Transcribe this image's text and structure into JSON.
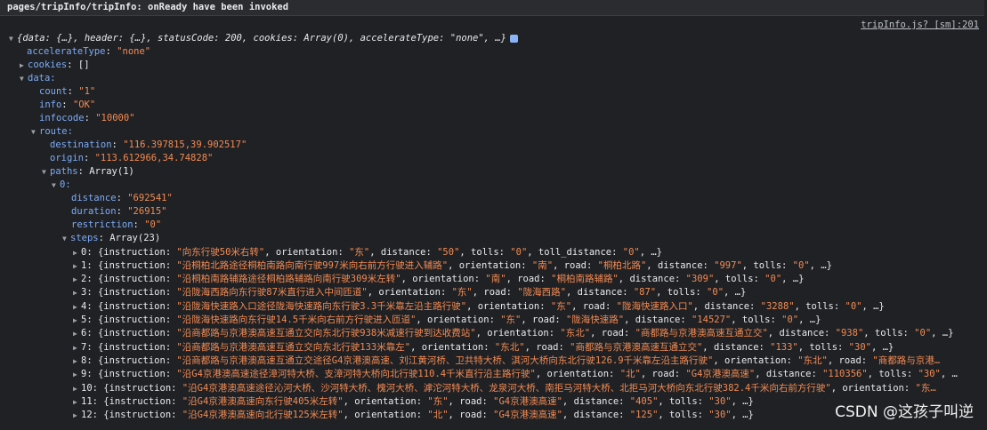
{
  "console": {
    "log_message": "pages/tripInfo/tripInfo: onReady have been invoked",
    "source_link": "tripInfo.js? [sm]:201",
    "summary": "{data: {…}, header: {…}, statusCode: 200, cookies: Array(0), accelerateType: \"none\", …}",
    "accelerateType": {
      "key": "accelerateType",
      "value": "\"none\""
    },
    "cookies": {
      "key": "cookies",
      "value": "[]"
    },
    "data": {
      "key": "data:"
    },
    "count": {
      "key": "count",
      "value": "\"1\""
    },
    "info": {
      "key": "info",
      "value": "\"OK\""
    },
    "infocode": {
      "key": "infocode",
      "value": "\"10000\""
    },
    "route": {
      "key": "route:"
    },
    "destination": {
      "key": "destination",
      "value": "\"116.397815,39.902517\""
    },
    "origin": {
      "key": "origin",
      "value": "\"113.612966,34.74828\""
    },
    "paths": {
      "key": "paths",
      "value": "Array(1)"
    },
    "path0": {
      "key": "0:"
    },
    "distance": {
      "key": "distance",
      "value": "\"692541\""
    },
    "duration": {
      "key": "duration",
      "value": "\"26915\""
    },
    "restriction": {
      "key": "restriction",
      "value": "\"0\""
    },
    "steps": {
      "key": "steps",
      "value": "Array(23)"
    },
    "step_rows": [
      "0: {instruction: \"向东行驶50米右转\", orientation: \"东\", distance: \"50\", tolls: \"0\", toll_distance: \"0\", …}",
      "1: {instruction: \"沿桐柏北路途径桐柏南路向南行驶997米向右前方行驶进入辅路\", orientation: \"南\", road: \"桐柏北路\", distance: \"997\", tolls: \"0\", …}",
      "2: {instruction: \"沿桐柏南路辅路途径桐柏路辅路向南行驶309米左转\", orientation: \"南\", road: \"桐柏南路辅路\", distance: \"309\", tolls: \"0\", …}",
      "3: {instruction: \"沿陇海西路向东行驶87米直行进入中间匝道\", orientation: \"东\", road: \"陇海西路\", distance: \"87\", tolls: \"0\", …}",
      "4: {instruction: \"沿陇海快速路入口途径陇海快速路向东行驶3.3千米靠左沿主路行驶\", orientation: \"东\", road: \"陇海快速路入口\", distance: \"3288\", tolls: \"0\", …}",
      "5: {instruction: \"沿陇海快速路向东行驶14.5千米向右前方行驶进入匝道\", orientation: \"东\", road: \"陇海快速路\", distance: \"14527\", tolls: \"0\", …}",
      "6: {instruction: \"沿商都路与京港澳高速互通立交向东北行驶938米减速行驶到达收费站\", orientation: \"东北\", road: \"商都路与京港澳高速互通立交\", distance: \"938\", tolls: \"0\", …}",
      "7: {instruction: \"沿商都路与京港澳高速互通立交向东北行驶133米靠左\", orientation: \"东北\", road: \"商都路与京港澳高速互通立交\", distance: \"133\", tolls: \"30\", …}",
      "8: {instruction: \"沿商都路与京港澳高速互通立交途径G4京港澳高速、刘江黄河桥、卫共特大桥、淇河大桥向东北行驶126.9千米靠左沿主路行驶\", orientation: \"东北\", road: \"商都路与京港…",
      "9: {instruction: \"沿G4京港澳高速途径漳河特大桥、支漳河特大桥向北行驶110.4千米直行沿主路行驶\", orientation: \"北\", road: \"G4京港澳高速\", distance: \"110356\", tolls: \"30\", …",
      "10: {instruction: \"沿G4京港澳高速途径沁河大桥、沙河特大桥、槐河大桥、滹沱河特大桥、龙泉河大桥、南拒马河特大桥、北拒马河大桥向东北行驶382.4千米向右前方行驶\", orientation: \"东…",
      "11: {instruction: \"沿G4京港澳高速向东行驶405米左转\", orientation: \"东\", road: \"G4京港澳高速\", distance: \"405\", tolls: \"30\", …}",
      "12: {instruction: \"沿G4京港澳高速向北行驶125米左转\", orientation: \"北\", road: \"G4京港澳高速\", distance: \"125\", tolls: \"30\", …}"
    ]
  },
  "watermark": "CSDN @这孩子叫逆"
}
